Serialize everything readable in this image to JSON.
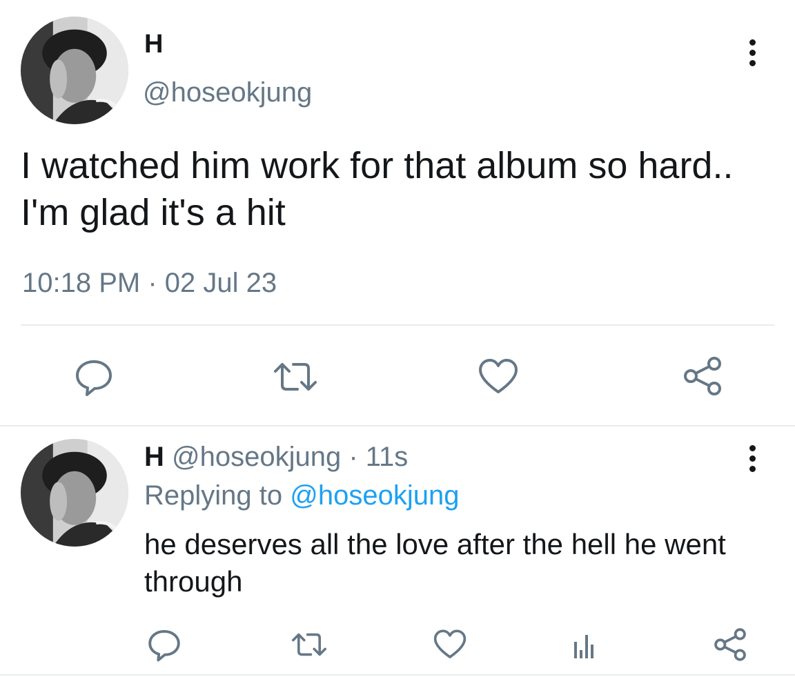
{
  "main_tweet": {
    "display_name": "H",
    "handle": "@hoseokjung",
    "text": "I watched him work for that album so hard.. I'm glad it's a hit",
    "timestamp": "10:18 PM · 02 Jul 23",
    "avatar": "profile-photo-grayscale"
  },
  "reply_tweet": {
    "display_name": "H",
    "handle": "@hoseokjung",
    "separator": " · ",
    "time": "11s",
    "replying_prefix": "Replying to ",
    "replying_to": "@hoseokjung",
    "text": "he deserves all the love after the hell he went through",
    "avatar": "profile-photo-grayscale"
  },
  "icons": {
    "reply": "speech-bubble-icon",
    "retweet": "retweet-arrows-icon",
    "like": "heart-icon",
    "share": "share-nodes-icon",
    "stats": "bar-stats-icon",
    "more": "vertical-ellipsis-icon"
  },
  "colors": {
    "text": "#14171a",
    "secondary": "#657786",
    "link": "#1da1f2",
    "divider": "#e6ecf0",
    "icon": "#657786"
  }
}
